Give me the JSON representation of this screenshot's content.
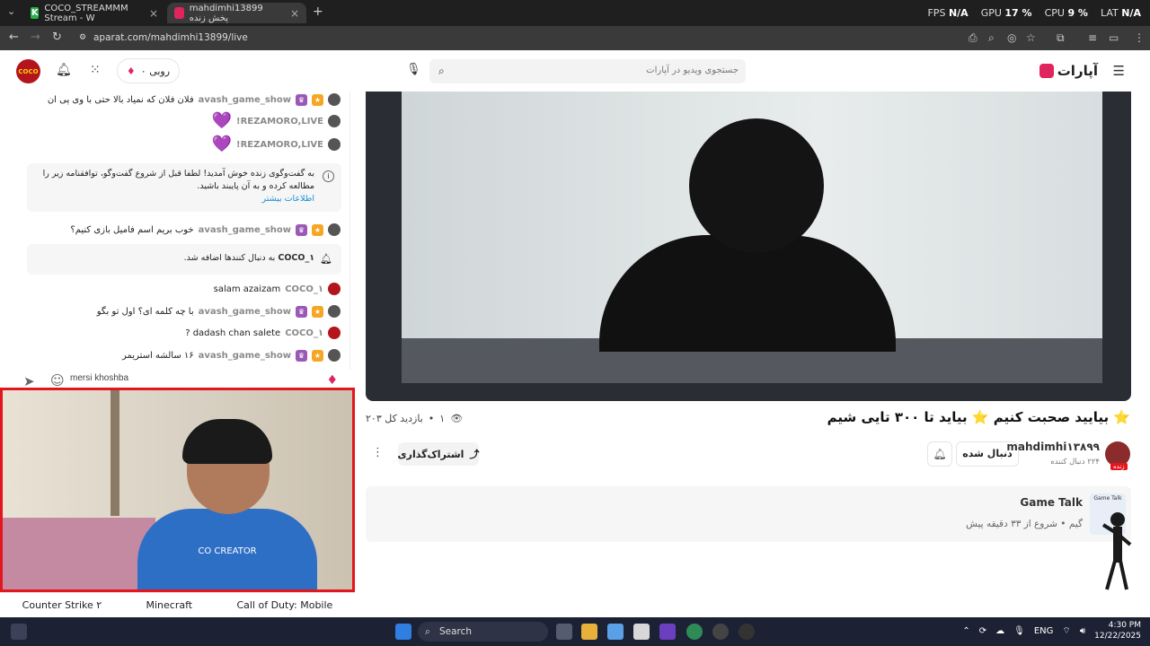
{
  "browser": {
    "tabs": [
      {
        "title": "COCO_STREAMMM Stream - W",
        "active": false
      },
      {
        "title": "mahdimhi13899 پخش زنده",
        "active": true
      }
    ],
    "url": "aparat.com/mahdimhi13899/live",
    "stats": {
      "fps_label": "FPS",
      "fps": "N/A",
      "gpu_label": "GPU",
      "gpu": "17 %",
      "cpu_label": "CPU",
      "cpu": "9 %",
      "lat_label": "LAT",
      "lat": "N/A"
    }
  },
  "header": {
    "brand": "آپارات",
    "search_placeholder": "جستجوی ویدیو در آپارات",
    "coins": "۰ روبی",
    "logo_text": "COCO"
  },
  "chat": {
    "messages": [
      {
        "user": "avash_game_show",
        "text": "فلان فلان که نمیاد بالا حتی با وی پی ان",
        "badges": true
      },
      {
        "user": "REZAMORO,LIVE!",
        "text": "💜",
        "badges": false
      },
      {
        "user": "REZAMORO,LIVE!",
        "text": "💜",
        "badges": false
      },
      {
        "user": "avash_game_show",
        "text": "خوب بریم اسم فامیل بازی کنیم؟",
        "badges": true
      },
      {
        "user": "COCO_۱",
        "text": "salam azaizam",
        "badges": false
      },
      {
        "user": "avash_game_show",
        "text": "با چه کلمه ای؟ اول تو بگو",
        "badges": true
      },
      {
        "user": "COCO_۱",
        "text": "dadash chan salete ?",
        "badges": false
      },
      {
        "user": "avash_game_show",
        "text": "۱۶ سالشه استریمر",
        "badges": true
      }
    ],
    "notice": "به گفت‌وگوی زنده خوش آمدید! لطفا قبل از شروع گفت‌وگو، توافقنامه زیر را مطالعه کرده و به آن پایبند باشید.",
    "notice_link": "اطلاعات بیشتر",
    "follow_user": "COCO_۱",
    "follow_text": "به دنبال کنندها اضافه شد.",
    "input_value": "mersi khoshba"
  },
  "webcam": {
    "shirt_text": "CO CREATOR"
  },
  "tags": [
    "Counter Strike ۲",
    "Minecraft",
    "Call of Duty: Mobile"
  ],
  "stream": {
    "title": "⭐ بیایید صحبت کنیم ⭐ بیاید تا ۳۰۰ تایی شیم",
    "viewers_now": "۱",
    "viewers_total": "۲۰۳ بازدید کل",
    "share": "اشتراک‌گذاری",
    "follow": "دنبال شده",
    "channel": "mahdimhi۱۳۸۹۹",
    "followers": "۲۲۴ دنبال کننده",
    "live": "زنده"
  },
  "game": {
    "title": "Game Talk",
    "category": "گیم",
    "started": "شروع از ۳۳ دقیقه پیش",
    "thumb_label": "Game Talk"
  },
  "taskbar": {
    "search": "Search",
    "lang": "ENG",
    "time": "4:30 PM",
    "date": "12/22/2025"
  }
}
